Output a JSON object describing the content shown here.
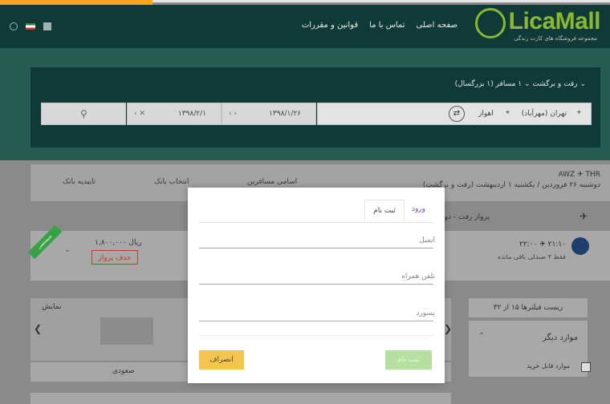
{
  "header": {
    "logo_text": "LicaMall",
    "logo_sub": "مجموعه فروشگاه های کارت زندگی",
    "nav": [
      "صفحه اصلی",
      "تماس با ما",
      "قوانین و مقررات"
    ]
  },
  "search": {
    "trip_options": "رفت و برگشت ⌄    ۱ مسافر (۱ بزرگسال) ⌄",
    "origin": "تهران (مهرآباد)",
    "destination": "اهواز",
    "swap": "⇄",
    "return_date": "۱۳۹۸/۱/۲۶",
    "return_arrows": "‹  ›",
    "depart_date": "۱۳۹۸/۲/۱",
    "depart_arrows": "‹ ✕",
    "search_icon": "⚲"
  },
  "steps": {
    "labels": [
      "تاییدیه بانک",
      "انتخاب بانک",
      "اسامی مسافرین"
    ],
    "route_code": "AWZ ✈ THR",
    "route_dates": "دوشنبه ۲۶ فروردین / یکشنبه ۱ اردیبهشت (رفت و برگشت)"
  },
  "flight": {
    "heading": "پرواز رفت - دوشنبه ۲۶ فروردین ۱۳۹۸",
    "time": "۲۲:۰۰ ✈ ۲۱:۱۰",
    "seats": "فقط ۳ صندلی باقی مانده",
    "price": "۱,۸۰۰,۰۰۰ ریال",
    "delete_label": "حذف پرواز",
    "ribbon": "سیستمی"
  },
  "sidebar": {
    "reset_label": "ریست فیلترها  ۱۵ از ۳۲",
    "other_title": "موارد دیگر",
    "check_label": "موارد قابل خرید"
  },
  "strip": {
    "title": "نمایش",
    "sort_label": "صعودی"
  },
  "modal": {
    "tab_login": "ورود",
    "tab_register": "ثبت نام",
    "email_placeholder": "ایمیل",
    "phone_placeholder": "تلفن همراه",
    "password_placeholder": "پسورد",
    "submit_label": "ثبت نام",
    "cancel_label": "انصراف"
  }
}
